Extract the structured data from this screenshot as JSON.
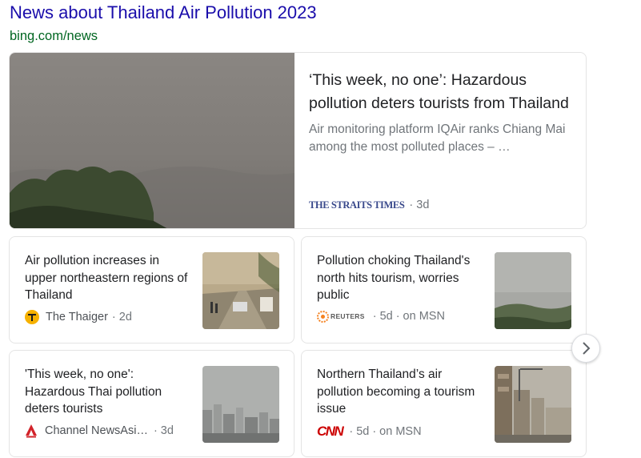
{
  "header": {
    "title": "News about Thailand Air Pollution 2023",
    "source": "bing.com/news"
  },
  "hero": {
    "headline": "‘This week, no one’: Hazardous pollution deters tourists from Thailand",
    "snippet": "Air monitoring platform IQAir ranks Chiang Mai among the most polluted places – …",
    "source_logo_text": "THE STRAITS TIMES",
    "age": "3d"
  },
  "cards": [
    {
      "headline": "Air pollution increases in upper northeastern regions of Thailand",
      "source": "The Thaiger",
      "age": "2d",
      "icon": "thaiger-logo-icon"
    },
    {
      "headline": "Pollution choking Thailand's north hits tourism, worries public",
      "source_logo_text": "REUTERS",
      "age": "5d",
      "via": "on MSN",
      "icon": "reuters-logo-icon"
    },
    {
      "headline": "'This week, no one': Hazardous Thai pollution deters tourists",
      "source": "Channel NewsAsi…",
      "age": "3d",
      "icon": "cna-logo-icon"
    },
    {
      "headline": "Northern Thailand’s air pollution becoming a tourism issue",
      "source_logo_text": "CNN",
      "age": "5d",
      "via": "on MSN",
      "icon": "cnn-logo-icon"
    }
  ],
  "separator": "·",
  "next_button_icon": "chevron-right-icon"
}
